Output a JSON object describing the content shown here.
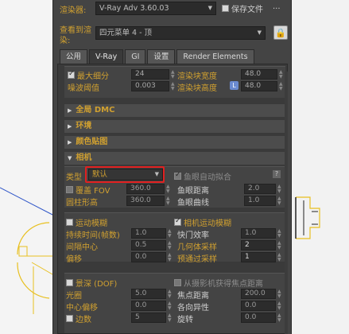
{
  "top": {
    "renderer_label": "渲染器:",
    "renderer_value": "V-Ray Adv 3.60.03",
    "save_file_label": "保存文件",
    "more_label": "...",
    "view_label_line1": "查看到渲",
    "view_label_line2": "染:",
    "view_value": "四元菜单 4 - 顶"
  },
  "tabs": [
    "公用",
    "V-Ray",
    "GI",
    "设置",
    "Render Elements"
  ],
  "image_sampler": {
    "max_subdiv_label": "最大细分",
    "max_subdiv_value": "24",
    "noise_threshold_label": "噪波阈值",
    "noise_threshold_value": "0.003",
    "bucket_width_label": "渲染块宽度",
    "bucket_width_value": "48.0",
    "bucket_height_label": "渲染块高度",
    "bucket_height_lock": "L",
    "bucket_height_value": "48.0"
  },
  "sections": {
    "global_dmc": "全局 DMC",
    "environment": "环境",
    "color_mapping": "颜色贴图",
    "camera": "相机"
  },
  "camera": {
    "type_label": "类型",
    "type_value": "默认",
    "override_fov_label": "覆盖 FOV",
    "override_fov_value": "360.0",
    "cylinder_height_label": "圆柱形高",
    "cylinder_height_value": "360.0",
    "auto_fit_label": "鱼眼自动拟合",
    "auto_fit_help": "?",
    "fisheye_dist_label": "鱼眼距离",
    "fisheye_dist_value": "2.0",
    "fisheye_curve_label": "鱼眼曲线",
    "fisheye_curve_value": "1.0"
  },
  "motion_blur": {
    "enable_label": "运动模糊",
    "duration_label": "持续时间(帧数)",
    "duration_value": "1.0",
    "interval_center_label": "间隔中心",
    "interval_center_value": "0.5",
    "bias_label": "偏移",
    "bias_value": "0.0",
    "camera_mb_label": "相机运动模糊",
    "shutter_eff_label": "快门效率",
    "shutter_eff_value": "1.0",
    "geom_samples_label": "几何体采样",
    "geom_samples_value": "2",
    "prepass_samples_label": "预通过采样",
    "prepass_samples_value": "1"
  },
  "dof": {
    "enable_label": "景深 (DOF)",
    "from_camera_label": "从摄影机获得焦点距离",
    "aperture_label": "光圈",
    "aperture_value": "5.0",
    "center_bias_label": "中心偏移",
    "center_bias_value": "0.0",
    "sides_label": "边数",
    "sides_value": "5",
    "focus_dist_label": "焦点距离",
    "focus_dist_value": "200.0",
    "anisotropy_label": "各向异性",
    "anisotropy_value": "0.0",
    "rotation_label": "旋转",
    "rotation_value": "0.0"
  },
  "colors": {
    "accent_label": "#d0a030",
    "highlight_box": "#e02020",
    "panel_bg": "#444444"
  }
}
